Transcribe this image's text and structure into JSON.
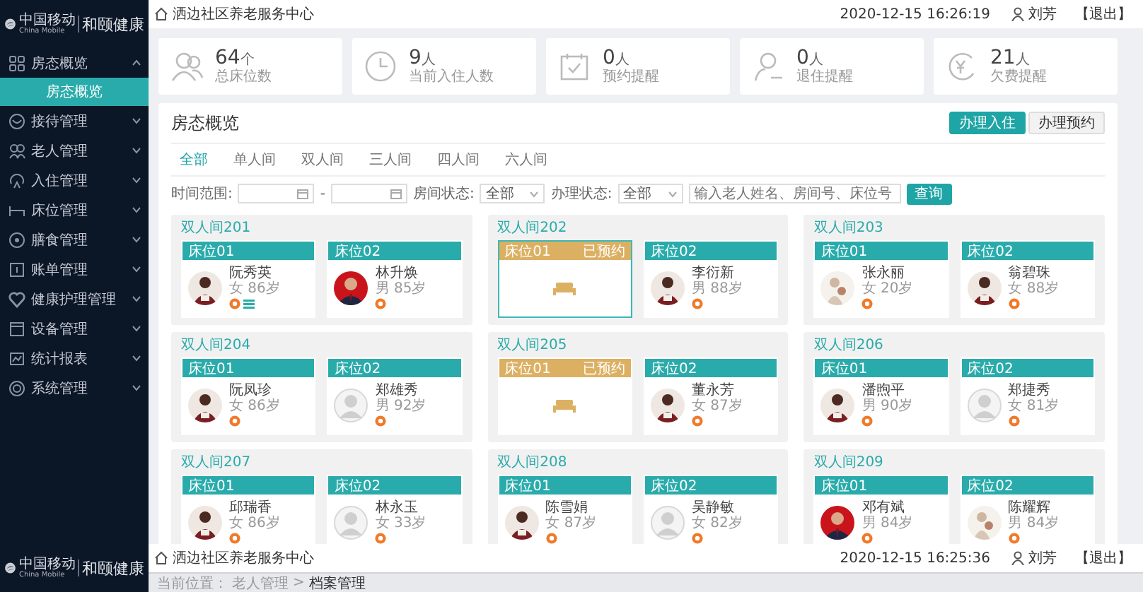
{
  "sidebar": {
    "logo": {
      "brand": "中国移动",
      "brand_en": "China Mobile",
      "product": "和颐健康"
    },
    "items": [
      {
        "label": "房态概览",
        "expanded": true,
        "children": [
          {
            "label": "房态概览",
            "selected": true
          }
        ]
      },
      {
        "label": "接待管理",
        "expanded": false
      },
      {
        "label": "老人管理",
        "expanded": false
      },
      {
        "label": "入住管理",
        "expanded": false
      },
      {
        "label": "床位管理",
        "expanded": false
      },
      {
        "label": "膳食管理",
        "expanded": false
      },
      {
        "label": "账单管理",
        "expanded": false
      },
      {
        "label": "健康护理管理",
        "expanded": false
      },
      {
        "label": "设备管理",
        "expanded": false
      },
      {
        "label": "统计报表",
        "expanded": false
      },
      {
        "label": "系统管理",
        "expanded": false
      }
    ],
    "footer_logo": {
      "brand": "中国移动",
      "brand_en": "China Mobile",
      "product": "和颐健康"
    }
  },
  "header": {
    "site": "洒边社区养老服务中心",
    "time": "2020-12-15 16:26:19",
    "user": "刘芳",
    "logout": "【退出】"
  },
  "stats": [
    {
      "value": "64",
      "unit": "个",
      "label": "总床位数"
    },
    {
      "value": "9",
      "unit": "人",
      "label": "当前入住人数"
    },
    {
      "value": "0",
      "unit": "人",
      "label": "预约提醒"
    },
    {
      "value": "0",
      "unit": "人",
      "label": "退住提醒"
    },
    {
      "value": "21",
      "unit": "人",
      "label": "欠费提醒"
    }
  ],
  "panel": {
    "title": "房态概览",
    "buttons": [
      {
        "label": "办理入住",
        "primary": true
      },
      {
        "label": "办理预约",
        "primary": false
      }
    ],
    "tabs": [
      {
        "label": "全部",
        "selected": true
      },
      {
        "label": "单人间",
        "selected": false
      },
      {
        "label": "双人间",
        "selected": false
      },
      {
        "label": "三人间",
        "selected": false
      },
      {
        "label": "四人间",
        "selected": false
      },
      {
        "label": "六人间",
        "selected": false
      }
    ],
    "filters": {
      "time_label": "时间范围:",
      "range_separator": "-",
      "room_status_label": "房间状态:",
      "room_status": "全部",
      "handle_status_label": "办理状态:",
      "handle_status": "全部",
      "search_placeholder": "输入老人姓名、房间号、床位号",
      "search_button": "查询"
    },
    "rooms": [
      {
        "name": "双人间201",
        "beds": [
          {
            "label": "床位01",
            "kind": "occupied",
            "selected": false,
            "name": "阮秀英",
            "info": "女 86岁",
            "avatar": {
              "kind": "picture"
            },
            "badges": [
              {
                "kind": "coin"
              },
              {
                "kind": "list"
              }
            ]
          },
          {
            "label": "床位02",
            "kind": "occupied",
            "selected": false,
            "name": "林升焕",
            "info": "男 85岁",
            "avatar": {
              "kind": "picture"
            },
            "badges": [
              {
                "kind": "coin"
              }
            ]
          }
        ]
      },
      {
        "name": "双人间202",
        "beds": [
          {
            "label": "床位01",
            "kind": "reserved",
            "status": "已预约",
            "selected": true
          },
          {
            "label": "床位02",
            "kind": "occupied",
            "selected": false,
            "name": "李衍新",
            "info": "男 88岁",
            "avatar": {
              "kind": "picture"
            },
            "badges": [
              {
                "kind": "coin"
              }
            ]
          }
        ]
      },
      {
        "name": "双人间203",
        "beds": [
          {
            "label": "床位01",
            "kind": "occupied",
            "selected": false,
            "name": "张永丽",
            "info": "女 20岁",
            "avatar": {
              "kind": "picture"
            },
            "badges": [
              {
                "kind": "coin"
              }
            ]
          },
          {
            "label": "床位02",
            "kind": "occupied",
            "selected": false,
            "name": "翁碧珠",
            "info": "女 88岁",
            "avatar": {
              "kind": "picture"
            },
            "badges": [
              {
                "kind": "coin"
              }
            ]
          }
        ]
      },
      {
        "name": "双人间204",
        "beds": [
          {
            "label": "床位01",
            "kind": "occupied",
            "selected": false,
            "name": "阮凤珍",
            "info": "女 86岁",
            "avatar": {
              "kind": "picture"
            },
            "badges": [
              {
                "kind": "coin"
              }
            ]
          },
          {
            "label": "床位02",
            "kind": "occupied",
            "selected": false,
            "name": "郑雄秀",
            "info": "男 92岁",
            "avatar": {
              "kind": "silhouette"
            },
            "badges": [
              {
                "kind": "coin"
              }
            ]
          }
        ]
      },
      {
        "name": "双人间205",
        "beds": [
          {
            "label": "床位01",
            "kind": "reserved",
            "status": "已预约",
            "selected": false
          },
          {
            "label": "床位02",
            "kind": "occupied",
            "selected": false,
            "name": "董永芳",
            "info": "女 87岁",
            "avatar": {
              "kind": "picture"
            },
            "badges": [
              {
                "kind": "coin"
              }
            ]
          }
        ]
      },
      {
        "name": "双人间206",
        "beds": [
          {
            "label": "床位01",
            "kind": "occupied",
            "selected": false,
            "name": "潘煦平",
            "info": "男 90岁",
            "avatar": {
              "kind": "picture"
            },
            "badges": [
              {
                "kind": "coin"
              }
            ]
          },
          {
            "label": "床位02",
            "kind": "occupied",
            "selected": false,
            "name": "郑捷秀",
            "info": "女 81岁",
            "avatar": {
              "kind": "silhouette"
            },
            "badges": [
              {
                "kind": "coin"
              }
            ]
          }
        ]
      },
      {
        "name": "双人间207",
        "beds": [
          {
            "label": "床位01",
            "kind": "occupied",
            "selected": false,
            "name": "邱瑞香",
            "info": "女 86岁",
            "avatar": {
              "kind": "picture"
            },
            "badges": [
              {
                "kind": "coin"
              }
            ]
          },
          {
            "label": "床位02",
            "kind": "occupied",
            "selected": false,
            "name": "林永玉",
            "info": "女 33岁",
            "avatar": {
              "kind": "silhouette"
            },
            "badges": [
              {
                "kind": "coin"
              }
            ]
          }
        ]
      },
      {
        "name": "双人间208",
        "beds": [
          {
            "label": "床位01",
            "kind": "occupied",
            "selected": false,
            "name": "陈雪娟",
            "info": "女 87岁",
            "avatar": {
              "kind": "picture"
            },
            "badges": [
              {
                "kind": "coin"
              }
            ]
          },
          {
            "label": "床位02",
            "kind": "occupied",
            "selected": false,
            "name": "吴静敏",
            "info": "女 82岁",
            "avatar": {
              "kind": "silhouette"
            },
            "badges": [
              {
                "kind": "coin"
              }
            ]
          }
        ]
      },
      {
        "name": "双人间209",
        "beds": [
          {
            "label": "床位01",
            "kind": "occupied",
            "selected": false,
            "name": "邓有斌",
            "info": "男 84岁",
            "avatar": {
              "kind": "picture"
            },
            "badges": [
              {
                "kind": "coin"
              }
            ]
          },
          {
            "label": "床位02",
            "kind": "occupied",
            "selected": false,
            "name": "陈耀辉",
            "info": "男 84岁",
            "avatar": {
              "kind": "picture"
            },
            "badges": [
              {
                "kind": "coin"
              }
            ]
          }
        ]
      }
    ]
  },
  "overlay": {
    "header": {
      "site": "洒边社区养老服务中心",
      "time": "2020-12-15 16:25:36",
      "user": "刘芳",
      "logout": "【退出】"
    },
    "breadcrumb": {
      "prefix": "当前位置：",
      "items": [
        "老人管理",
        "档案管理"
      ],
      "separator": ">"
    }
  }
}
